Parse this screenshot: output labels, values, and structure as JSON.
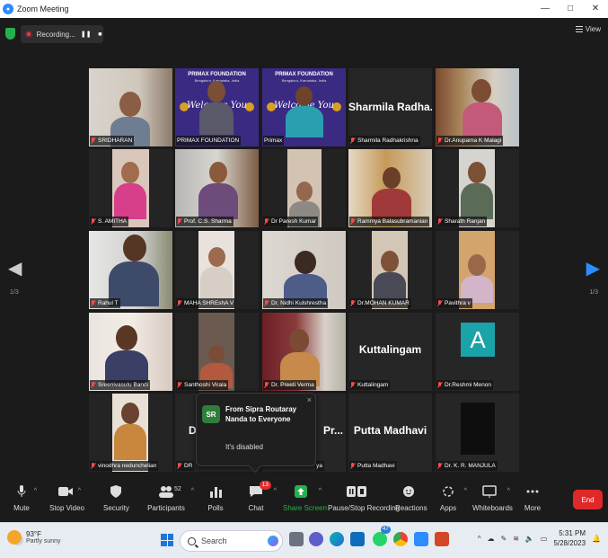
{
  "window": {
    "title": "Zoom Meeting",
    "controls": [
      "—",
      "□",
      "✕"
    ]
  },
  "topbar": {
    "recording_label": "Recording...",
    "view_label": "View"
  },
  "pagination": {
    "left": "1/3",
    "right": "1/3"
  },
  "participants": [
    {
      "name": "SRIDHARAN",
      "muted": true
    },
    {
      "name": "PRIMAX FOUNDATION",
      "muted": false,
      "active": true,
      "banner": {
        "title": "PRIMAX FOUNDATION",
        "subtitle": "Bengaluru, Karnataka, India",
        "welcome": "Welcome You"
      }
    },
    {
      "name": "Primax",
      "muted": false,
      "banner": {
        "title": "PRIMAX FOUNDATION",
        "subtitle": "Bengaluru, Karnataka, India",
        "welcome": "Welcome You"
      }
    },
    {
      "name": "Sharmila Radhakrishna",
      "muted": true,
      "big": "Sharmila Radha..."
    },
    {
      "name": "Dr.Anupama K Malagi",
      "muted": true
    },
    {
      "name": "S. AMITHA",
      "muted": true
    },
    {
      "name": "Prof. C.S. Sharma",
      "muted": true
    },
    {
      "name": "Dr Paresh Kumar",
      "muted": true
    },
    {
      "name": "Rammya Balasubramanian",
      "muted": true
    },
    {
      "name": "Sharath Ranjan",
      "muted": true
    },
    {
      "name": "Rahul T",
      "muted": true
    },
    {
      "name": "MAHA SHREshA V",
      "muted": true
    },
    {
      "name": "Dr. Nidhi Kulshrestha",
      "muted": true
    },
    {
      "name": "Dr.MOHAN KUMAR",
      "muted": true
    },
    {
      "name": "Pavithra v",
      "muted": true
    },
    {
      "name": "Sreenivasulu Bandi",
      "muted": true
    },
    {
      "name": "Santhoshi Virala",
      "muted": true
    },
    {
      "name": "Dr. Preeti Verma",
      "muted": true
    },
    {
      "name": "Kuttalingam",
      "muted": true,
      "big": "Kuttalingam"
    },
    {
      "name": "Dr.Reshmi Menon",
      "muted": true,
      "avatar_letter": "A"
    },
    {
      "name": "vinodhra nedunchelian",
      "muted": true
    },
    {
      "name": "DR",
      "muted": true,
      "big": "D"
    },
    {
      "name": "ya",
      "muted": false,
      "big": "Pr..."
    },
    {
      "name": "Putta Madhavi",
      "muted": true,
      "big": "Putta Madhavi"
    },
    {
      "name": "Dr. K. R. MANJULA",
      "muted": true
    }
  ],
  "chat_popup": {
    "initials": "SR",
    "from": "From Sipra Routaray Nanda to Everyone",
    "message": "It's disabled",
    "close": "×"
  },
  "toolbar": {
    "mute": "Mute",
    "stop_video": "Stop Video",
    "security": "Security",
    "participants": "Participants",
    "participants_count": "52",
    "polls": "Polls",
    "chat": "Chat",
    "chat_badge": "13",
    "share_screen": "Share Screen",
    "recording": "Pause/Stop Recording",
    "reactions": "Reactions",
    "apps": "Apps",
    "whiteboards": "Whiteboards",
    "more": "More",
    "end": "End"
  },
  "taskbar": {
    "temperature": "93°F",
    "weather": "Partly sunny",
    "search": "Search",
    "badge_whatsapp": "47",
    "time": "5:31 PM",
    "date": "5/28/2023"
  },
  "colors": {
    "accent_green": "#23b14d",
    "end_red": "#e02828",
    "active_border": "#e5e56a",
    "banner_purple": "#3b2a82"
  }
}
